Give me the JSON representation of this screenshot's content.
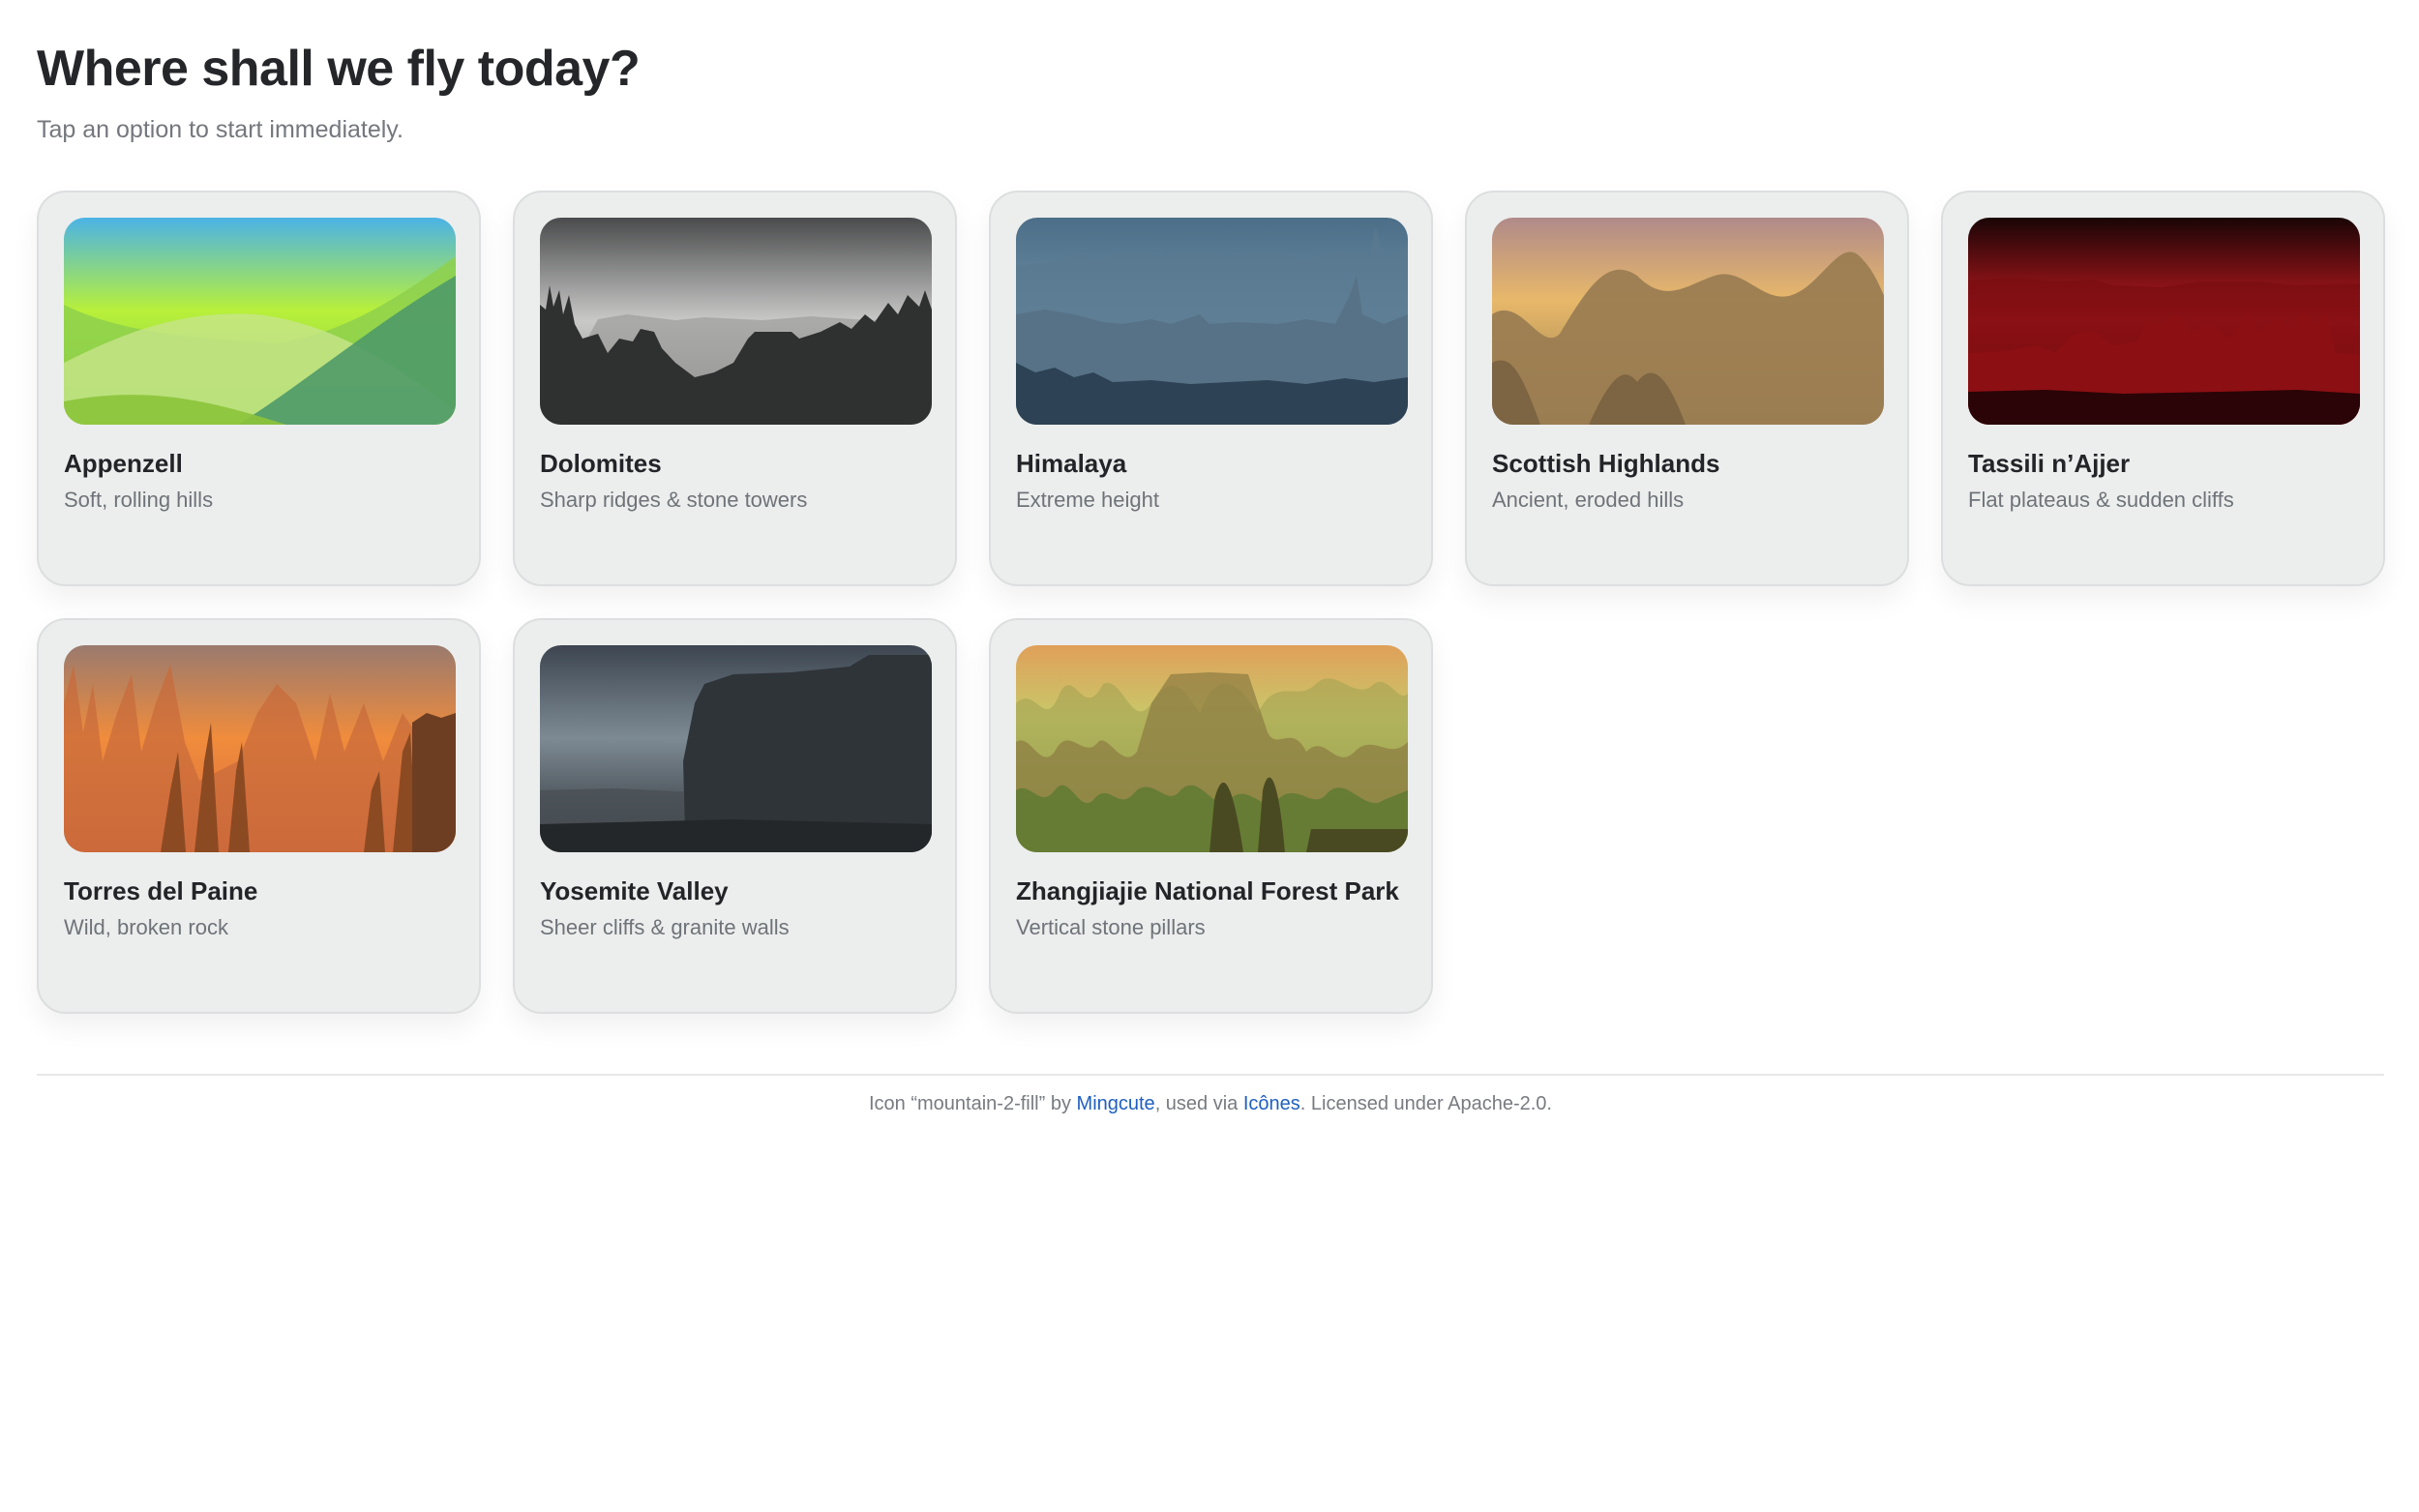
{
  "header": {
    "title": "Where shall we fly today?",
    "subtitle": "Tap an option to start immediately."
  },
  "destinations": [
    {
      "name": "Appenzell",
      "description": "Soft, rolling hills",
      "scene": "green-rolling-hills"
    },
    {
      "name": "Dolomites",
      "description": "Sharp ridges & stone towers",
      "scene": "grey-stone-towers"
    },
    {
      "name": "Himalaya",
      "description": "Extreme height",
      "scene": "blue-steel-peaks"
    },
    {
      "name": "Scottish Highlands",
      "description": "Ancient, eroded hills",
      "scene": "golden-eroded-hills"
    },
    {
      "name": "Tassili n’Ajjer",
      "description": "Flat plateaus & sudden cliffs",
      "scene": "crimson-plateaus"
    },
    {
      "name": "Torres del Paine",
      "description": "Wild, broken rock",
      "scene": "orange-spires"
    },
    {
      "name": "Yosemite Valley",
      "description": "Sheer cliffs & granite walls",
      "scene": "slate-granite-cliff"
    },
    {
      "name": "Zhangjiajie National Forest Park",
      "description": "Vertical stone pillars",
      "scene": "olive-stone-pillars"
    }
  ],
  "footer": {
    "prefix": "Icon “mountain-2-fill” by ",
    "author_link": "Mingcute",
    "middle": ", used via ",
    "source_link": "Icônes",
    "suffix": ". Licensed under Apache-2.0."
  },
  "colors": {
    "card_background": "#eceeed",
    "card_border": "#dcdedf",
    "link": "#1f5fbf"
  }
}
